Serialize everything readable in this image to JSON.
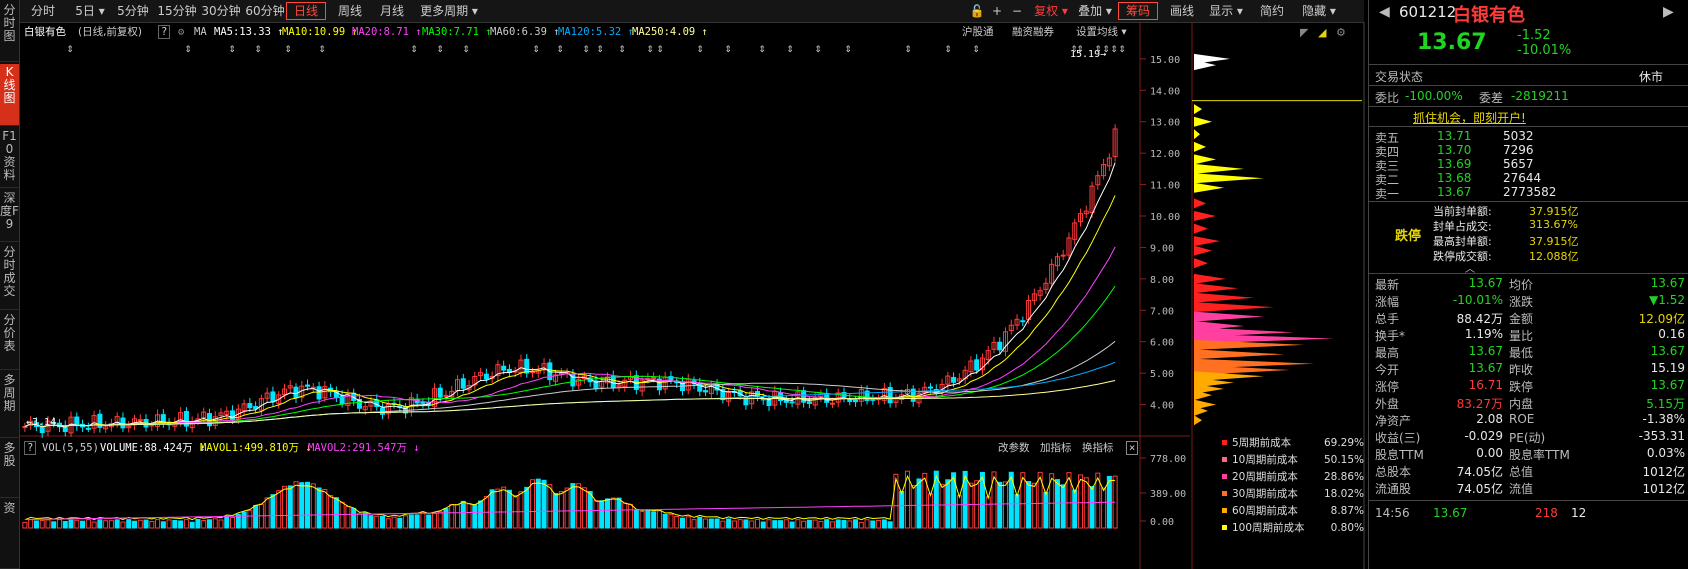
{
  "left_tabs": [
    {
      "label": "分时图",
      "active": false
    },
    {
      "label": "K线图",
      "active": true
    },
    {
      "label": "F10资料",
      "active": false
    },
    {
      "label": "深度F9",
      "active": false
    },
    {
      "label": "分时成交",
      "active": false
    },
    {
      "label": "分价表",
      "active": false
    },
    {
      "label": "多周期",
      "active": false
    },
    {
      "label": "多股",
      "active": false
    },
    {
      "label": "资",
      "active": false
    }
  ],
  "toolbar": {
    "periods": [
      "分时",
      "5日 ▾",
      "5分钟",
      "15分钟",
      "30分钟",
      "60分钟",
      "日线",
      "周线",
      "月线",
      "更多周期 ▾"
    ],
    "selected_period": "日线",
    "lock_icon": "🔓",
    "plus": "+",
    "minus": "−",
    "right_items": [
      "复权 ▾",
      "叠加 ▾",
      "筹码",
      "画线",
      "显示 ▾",
      "简约",
      "隐藏 ▾"
    ]
  },
  "ma_bar": {
    "name": "白银有色",
    "mode": "(日线,前复权)",
    "help": "?",
    "ma": "MA",
    "ma5": "MA5:13.33 ↑",
    "ma10": "MA10:10.99 ↑",
    "ma20": "MA20:8.71 ↑",
    "ma30": "MA30:7.71 ↑",
    "ma60": "MA60:6.39 ↑",
    "ma120": "MA120:5.32 ↑",
    "ma250": "MA250:4.09 ↑",
    "right_links": [
      "沪股通",
      "融资融券",
      "设置均线 ▾"
    ]
  },
  "colors": {
    "up": "#ff3a3a",
    "down": "#00e5ff",
    "ma5": "#ffffff",
    "ma10": "#ffff00",
    "ma20": "#ff40ff",
    "ma30": "#00ff00",
    "ma60": "#cccccc",
    "ma120": "#00aaff",
    "ma250": "#ffff99"
  },
  "kline": {
    "price_ticks": [
      "15.00",
      "14.00",
      "13.00",
      "12.00",
      "11.00",
      "10.00",
      "9.00",
      "8.00",
      "7.00",
      "6.00",
      "5.00",
      "4.00"
    ],
    "price_range": [
      3.0,
      15.6
    ],
    "high_label": "15.19",
    "low_label": "3.14",
    "current_price_line": 13.67
  },
  "vol_bar": {
    "help": "?",
    "vol": "VOL(5,55)",
    "volume": "VOLUME:88.424万 ↓",
    "mavol1": "MAVOL1:499.810万 ↓",
    "mavol2": "MAVOL2:291.547万 ↓",
    "right_links": [
      "改参数",
      "加指标",
      "换指标"
    ],
    "close": "×",
    "ticks": [
      "778.00",
      "389.00",
      "0.00"
    ]
  },
  "chip_legend": [
    {
      "label": "5周期前成本",
      "pct": "69.29%",
      "color": "#ff2020"
    },
    {
      "label": "10周期前成本",
      "pct": "50.15%",
      "color": "#ff6688"
    },
    {
      "label": "20周期前成本",
      "pct": "28.86%",
      "color": "#ff40a0"
    },
    {
      "label": "30周期前成本",
      "pct": "18.02%",
      "color": "#ff7020"
    },
    {
      "label": "60周期前成本",
      "pct": "8.87%",
      "color": "#ffaa00"
    },
    {
      "label": "100周期前成本",
      "pct": "0.80%",
      "color": "#ffff00"
    }
  ],
  "quote": {
    "code": "601212",
    "name": "白银有色",
    "price": "13.67",
    "change": "-1.52",
    "change_pct": "-10.01%",
    "trade_status_label": "交易状态",
    "trade_status": "休市",
    "wb_label": "委比",
    "wb": "-100.00%",
    "wc_label": "委差",
    "wc": "-2819211",
    "banner": "抓住机会，即刻开户!",
    "asks": [
      {
        "label": "卖五",
        "price": "13.71",
        "vol": "5032"
      },
      {
        "label": "卖四",
        "price": "13.70",
        "vol": "7296"
      },
      {
        "label": "卖三",
        "price": "13.69",
        "vol": "5657"
      },
      {
        "label": "卖二",
        "price": "13.68",
        "vol": "27644"
      },
      {
        "label": "卖一",
        "price": "13.67",
        "vol": "2773582"
      }
    ],
    "limit_label": "跌停",
    "limit_rows": [
      {
        "label": "当前封单额:",
        "value": "37.915亿"
      },
      {
        "label": "封单占成交:",
        "value": "313.67%"
      },
      {
        "label": "最高封单额:",
        "value": "37.915亿"
      },
      {
        "label": "跌停成交额:",
        "value": "12.088亿"
      }
    ],
    "stats": [
      {
        "l1": "最新",
        "v1": "13.67",
        "c1": "green",
        "l2": "均价",
        "v2": "13.67",
        "c2": "green"
      },
      {
        "l1": "涨幅",
        "v1": "-10.01%",
        "c1": "green",
        "l2": "涨跌",
        "v2": "▼1.52",
        "c2": "green"
      },
      {
        "l1": "总手",
        "v1": "88.42万",
        "c1": "white",
        "l2": "金额",
        "v2": "12.09亿",
        "c2": "yellow"
      },
      {
        "l1": "换手*",
        "v1": "1.19%",
        "c1": "white",
        "l2": "量比",
        "v2": "0.16",
        "c2": "white"
      },
      {
        "l1": "最高",
        "v1": "13.67",
        "c1": "green",
        "l2": "最低",
        "v2": "13.67",
        "c2": "green"
      },
      {
        "l1": "今开",
        "v1": "13.67",
        "c1": "green",
        "l2": "昨收",
        "v2": "15.19",
        "c2": "white"
      },
      {
        "l1": "涨停",
        "v1": "16.71",
        "c1": "red",
        "l2": "跌停",
        "v2": "13.67",
        "c2": "green"
      },
      {
        "l1": "外盘",
        "v1": "83.27万",
        "c1": "red",
        "l2": "内盘",
        "v2": "5.15万",
        "c2": "green"
      },
      {
        "l1": "净资产",
        "v1": "2.08",
        "c1": "white",
        "l2": "ROE",
        "v2": "-1.38%",
        "c2": "white"
      },
      {
        "l1": "收益(三)",
        "v1": "-0.029",
        "c1": "white",
        "l2": "PE(动)",
        "v2": "-353.31",
        "c2": "white"
      },
      {
        "l1": "股息TTM",
        "v1": "0.00",
        "c1": "white",
        "l2": "股息率TTM",
        "v2": "0.03%",
        "c2": "white"
      },
      {
        "l1": "总股本",
        "v1": "74.05亿",
        "c1": "white",
        "l2": "总值",
        "v2": "1012亿",
        "c2": "white"
      },
      {
        "l1": "流通股",
        "v1": "74.05亿",
        "c1": "white",
        "l2": "流值",
        "v2": "1012亿",
        "c2": "white"
      }
    ],
    "tick": {
      "time": "14:56",
      "price": "13.67",
      "vol": "218",
      "num": "12"
    }
  }
}
